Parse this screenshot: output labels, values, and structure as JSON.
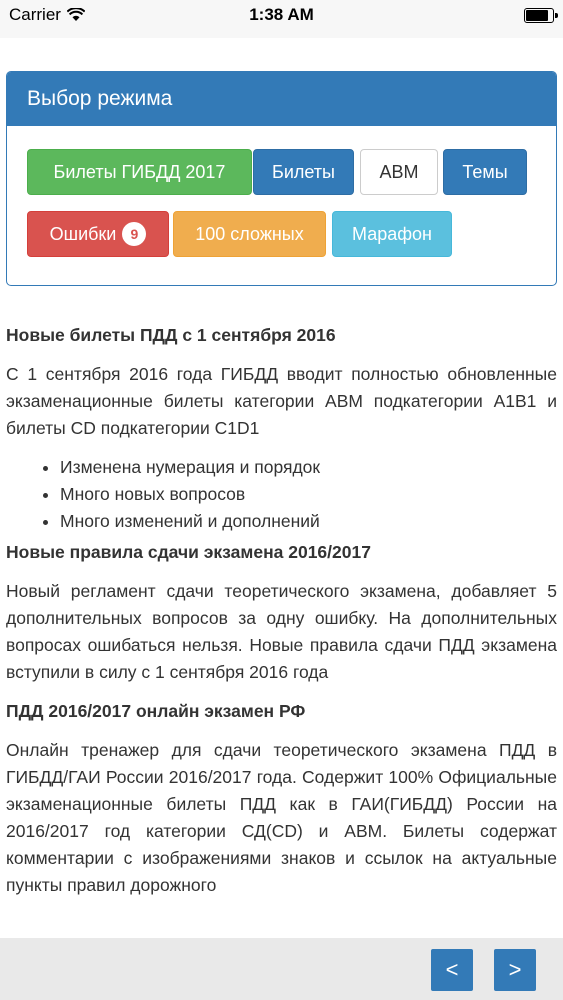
{
  "status_bar": {
    "carrier": "Carrier",
    "time": "1:38 AM"
  },
  "panel": {
    "title": "Выбор режима",
    "buttons": {
      "tickets_2017": "Билеты ГИБДД 2017",
      "tickets": "Билеты",
      "abm": "ABM",
      "topics": "Темы",
      "errors": "Ошибки",
      "errors_count": "9",
      "hard100": "100 сложных",
      "marathon": "Марафон"
    }
  },
  "article": {
    "h1": "Новые билеты ПДД с 1 сентября 2016",
    "p1": "С 1 сентября 2016 года ГИБДД вводит полностью обновленные экзаменационные билеты категории ABM подкатегории A1B1 и билеты CD подкатегории C1D1",
    "list": [
      "Изменена нумерация и порядок",
      "Много новых вопросов",
      "Много изменений и дополнений"
    ],
    "h2": "Новые правила сдачи экзамена 2016/2017",
    "p2": "Новый регламент сдачи теоретического экзамена, добавляет 5 дополнительных вопросов за одну ошибку. На дополнительных вопросах ошибаться нельзя. Новые правила сдачи ПДД экзамена вступили в силу с 1 сентября 2016 года",
    "h3": "ПДД 2016/2017 онлайн экзамен РФ",
    "p3": "Онлайн тренажер для сдачи теоретического экзамена ПДД в ГИБДД/ГАИ России 2016/2017 года. Содержит 100% Официальные экзаменационные билеты ПДД как в ГАИ(ГИБДД) России на 2016/2017 год категории СД(CD) и ABM. Билеты содержат комментарии с изображениями знаков и ссылок на актуальные пункты правил дорожного"
  },
  "nav": {
    "prev": "<",
    "next": ">"
  },
  "colors": {
    "primary": "#337ab7",
    "success": "#5cb85c",
    "danger": "#d9534f",
    "warning": "#f0ad4e",
    "info": "#5bc0de"
  }
}
